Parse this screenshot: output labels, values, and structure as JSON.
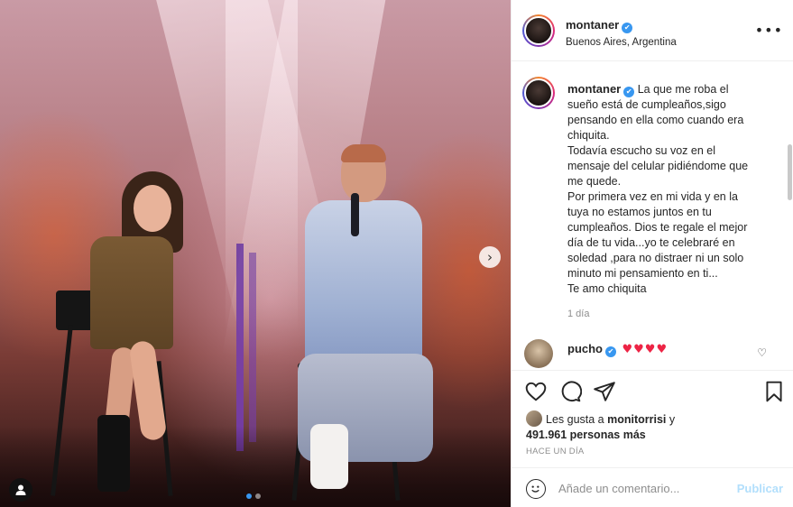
{
  "post": {
    "author": "montaner",
    "location": "Buenos Aires, Argentina",
    "caption_lines": [
      "La que me roba el",
      "sueño está de cumpleaños,sigo",
      "pensando en ella como cuando era",
      "chiquita.",
      "Todavía escucho su voz en el",
      "mensaje del celular pidiéndome que",
      "me quede.",
      "Por primera vez en mi vida y en la",
      "tuya no estamos juntos en tu",
      "cumpleaños. Dios te regale el mejor",
      "día de tu vida...yo te celebraré en",
      "soledad ,para no distraer ni un solo",
      "minuto mi pensamiento en ti...",
      "Te amo chiquita"
    ],
    "caption_time": "1 día",
    "comment": {
      "user": "pucho",
      "text": "♥♥♥♥"
    },
    "likes": {
      "prefix": "Les gusta a",
      "first_user": "monitorrisi",
      "and": "y",
      "count_text": "491.961 personas más"
    },
    "timestamp": "HACE UN DÍA",
    "comment_placeholder": "Añade un comentario...",
    "publish_label": "Publicar",
    "more_label": "•••",
    "verified_mark": "✔",
    "next_arrow": "›"
  },
  "colors": {
    "verified_blue": "#3897f0",
    "heart_red": "#ed2445",
    "publish_disabled": "#b2dffc"
  },
  "carousel": {
    "slide_count": 2,
    "active_index": 0
  }
}
